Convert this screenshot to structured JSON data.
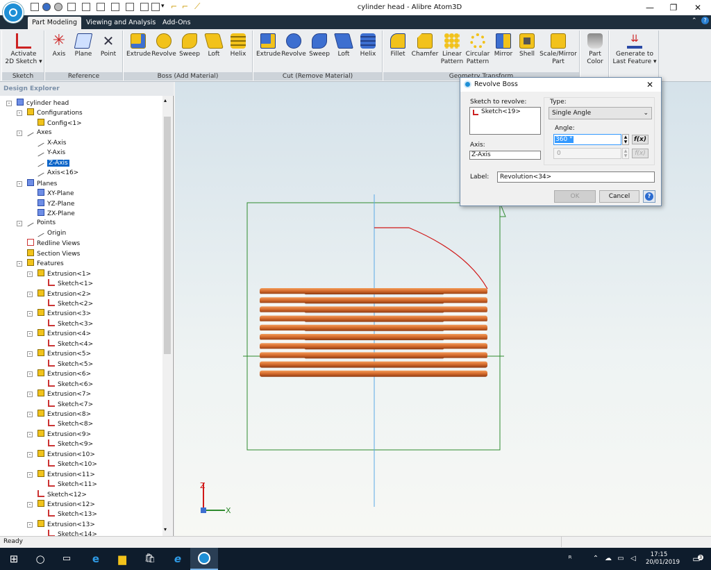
{
  "window": {
    "title": "cylinder head - Alibre Atom3D",
    "controls": {
      "minimize": "—",
      "maximize": "❐",
      "close": "✕"
    }
  },
  "tabs": [
    {
      "label": "Part Modeling"
    },
    {
      "label": "Viewing and Analysis"
    },
    {
      "label": "Add-Ons"
    }
  ],
  "ribbon": {
    "sketch": {
      "label": "Sketch",
      "activate_line1": "Activate",
      "activate_line2": "2D Sketch ▾"
    },
    "reference": {
      "label": "Reference",
      "axis": "Axis",
      "plane": "Plane",
      "point": "Point"
    },
    "boss": {
      "label": "Boss (Add Material)",
      "extrude": "Extrude",
      "revolve": "Revolve",
      "sweep": "Sweep",
      "loft": "Loft",
      "helix": "Helix"
    },
    "cut": {
      "label": "Cut (Remove Material)",
      "extrude": "Extrude",
      "revolve": "Revolve",
      "sweep": "Sweep",
      "loft": "Loft",
      "helix": "Helix"
    },
    "transform": {
      "label": "Geometry Transform",
      "fillet": "Fillet",
      "chamfer": "Chamfer",
      "linear_pattern_1": "Linear",
      "linear_pattern_2": "Pattern",
      "circular_pattern_1": "Circular",
      "circular_pattern_2": "Pattern",
      "mirror": "Mirror",
      "shell": "Shell",
      "scale_mirror_1": "Scale/Mirror",
      "scale_mirror_2": "Part"
    },
    "part_color_1": "Part",
    "part_color_2": "Color",
    "generate_1": "Generate to",
    "generate_2": "Last Feature ▾"
  },
  "explorer": {
    "title": "Design Explorer",
    "items": [
      {
        "label": "cylinder head",
        "icon": "part"
      },
      {
        "label": "Configurations",
        "icon": "folder"
      },
      {
        "label": "Config<1>",
        "icon": "config"
      },
      {
        "label": "Axes",
        "icon": "axis"
      },
      {
        "label": "X-Axis",
        "icon": "axis"
      },
      {
        "label": "Y-Axis",
        "icon": "axis"
      },
      {
        "label": "Z-Axis",
        "icon": "axis"
      },
      {
        "label": "Axis<16>",
        "icon": "axis"
      },
      {
        "label": "Planes",
        "icon": "plane"
      },
      {
        "label": "XY-Plane",
        "icon": "plane"
      },
      {
        "label": "YZ-Plane",
        "icon": "plane"
      },
      {
        "label": "ZX-Plane",
        "icon": "plane"
      },
      {
        "label": "Points",
        "icon": "point"
      },
      {
        "label": "Origin",
        "icon": "point"
      },
      {
        "label": "Redline Views",
        "icon": "redline"
      },
      {
        "label": "Section Views",
        "icon": "section"
      },
      {
        "label": "Features",
        "icon": "folder"
      },
      {
        "label": "Extrusion<1>",
        "icon": "extrusion"
      },
      {
        "label": "Sketch<1>",
        "icon": "sketch"
      },
      {
        "label": "Extrusion<2>",
        "icon": "extrusion"
      },
      {
        "label": "Sketch<2>",
        "icon": "sketch"
      },
      {
        "label": "Extrusion<3>",
        "icon": "extrusion"
      },
      {
        "label": "Sketch<3>",
        "icon": "sketch"
      },
      {
        "label": "Extrusion<4>",
        "icon": "extrusion"
      },
      {
        "label": "Sketch<4>",
        "icon": "sketch"
      },
      {
        "label": "Extrusion<5>",
        "icon": "extrusion"
      },
      {
        "label": "Sketch<5>",
        "icon": "sketch"
      },
      {
        "label": "Extrusion<6>",
        "icon": "extrusion"
      },
      {
        "label": "Sketch<6>",
        "icon": "sketch"
      },
      {
        "label": "Extrusion<7>",
        "icon": "extrusion"
      },
      {
        "label": "Sketch<7>",
        "icon": "sketch"
      },
      {
        "label": "Extrusion<8>",
        "icon": "extrusion"
      },
      {
        "label": "Sketch<8>",
        "icon": "sketch"
      },
      {
        "label": "Extrusion<9>",
        "icon": "extrusion"
      },
      {
        "label": "Sketch<9>",
        "icon": "sketch"
      },
      {
        "label": "Extrusion<10>",
        "icon": "extrusion"
      },
      {
        "label": "Sketch<10>",
        "icon": "sketch"
      },
      {
        "label": "Extrusion<11>",
        "icon": "extrusion"
      },
      {
        "label": "Sketch<11>",
        "icon": "sketch"
      },
      {
        "label": "Sketch<12>",
        "icon": "sketch"
      },
      {
        "label": "Extrusion<12>",
        "icon": "extrusion"
      },
      {
        "label": "Sketch<13>",
        "icon": "sketch"
      },
      {
        "label": "Extrusion<13>",
        "icon": "extrusion"
      },
      {
        "label": "Sketch<14>",
        "icon": "sketch"
      }
    ],
    "selected": "Z-Axis"
  },
  "dialog": {
    "title": "Revolve Boss",
    "sketch_label": "Sketch to revolve:",
    "sketch_value": "Sketch<19>",
    "axis_label": "Axis:",
    "axis_value": "Z-Axis",
    "type_label": "Type:",
    "type_value": "Single Angle",
    "angle_label": "Angle:",
    "angle_value": "360 °",
    "angle2_value": "0",
    "fx": "f(x)",
    "label_label": "Label:",
    "label_value": "Revolution<34>",
    "ok": "OK",
    "cancel": "Cancel",
    "help": "?"
  },
  "viewport": {
    "axis_z": "Z",
    "axis_x": "X"
  },
  "status": {
    "text": "Ready"
  },
  "taskbar": {
    "time": "17:15",
    "date": "20/01/2019",
    "notifications": "3"
  },
  "colors": {
    "accent": "#1e8fd6",
    "sketch_red": "#d01818",
    "fin_orange": "#d2692b",
    "frame_green": "#2e8b2e",
    "axis_blue": "#5aa9e6"
  }
}
